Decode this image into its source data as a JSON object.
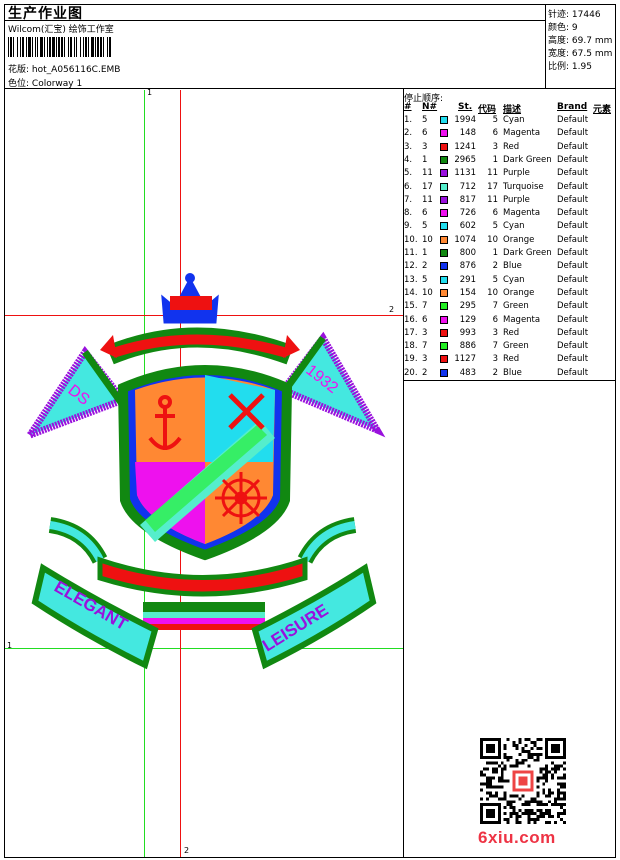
{
  "header": {
    "title": "生产作业图",
    "company": "Wilcom(汇宝) 绘饰工作室",
    "design_label": "花版:",
    "design_name": "hot_A056116C.EMB",
    "colorway_label": "色位:",
    "colorway_name": "Colorway 1"
  },
  "stats": {
    "stitches_label": "针迹:",
    "stitches": "17446",
    "colors_label": "颜色:",
    "colors": "9",
    "height_label": "高度:",
    "height": "69.7 mm",
    "width_label": "宽度:",
    "width": "67.5 mm",
    "scale_label": "比例:",
    "scale": "1.95"
  },
  "stop_sequence": {
    "title": "停止顺序:",
    "headers": {
      "idx": "#",
      "num": "N#",
      "st": "St.",
      "code": "代码",
      "desc": "描述",
      "brand": "Brand",
      "elem": "元素"
    },
    "rows": [
      {
        "idx": "1.",
        "n": "5",
        "color": "#22ddee",
        "st": "1994",
        "code": "5",
        "desc": "Cyan",
        "brand": "Default"
      },
      {
        "idx": "2.",
        "n": "6",
        "color": "#ee11ee",
        "st": "148",
        "code": "6",
        "desc": "Magenta",
        "brand": "Default"
      },
      {
        "idx": "3.",
        "n": "3",
        "color": "#ee1111",
        "st": "1241",
        "code": "3",
        "desc": "Red",
        "brand": "Default"
      },
      {
        "idx": "4.",
        "n": "1",
        "color": "#118811",
        "st": "2965",
        "code": "1",
        "desc": "Dark Green",
        "brand": "Default"
      },
      {
        "idx": "5.",
        "n": "11",
        "color": "#9911dd",
        "st": "1131",
        "code": "11",
        "desc": "Purple",
        "brand": "Default"
      },
      {
        "idx": "6.",
        "n": "17",
        "color": "#55eecc",
        "st": "712",
        "code": "17",
        "desc": "Turquoise",
        "brand": "Default"
      },
      {
        "idx": "7.",
        "n": "11",
        "color": "#9911dd",
        "st": "817",
        "code": "11",
        "desc": "Purple",
        "brand": "Default"
      },
      {
        "idx": "8.",
        "n": "6",
        "color": "#ee11ee",
        "st": "726",
        "code": "6",
        "desc": "Magenta",
        "brand": "Default"
      },
      {
        "idx": "9.",
        "n": "5",
        "color": "#22ddee",
        "st": "602",
        "code": "5",
        "desc": "Cyan",
        "brand": "Default"
      },
      {
        "idx": "10.",
        "n": "10",
        "color": "#ff8833",
        "st": "1074",
        "code": "10",
        "desc": "Orange",
        "brand": "Default"
      },
      {
        "idx": "11.",
        "n": "1",
        "color": "#118811",
        "st": "800",
        "code": "1",
        "desc": "Dark Green",
        "brand": "Default"
      },
      {
        "idx": "12.",
        "n": "2",
        "color": "#1133ee",
        "st": "876",
        "code": "2",
        "desc": "Blue",
        "brand": "Default"
      },
      {
        "idx": "13.",
        "n": "5",
        "color": "#22ddee",
        "st": "291",
        "code": "5",
        "desc": "Cyan",
        "brand": "Default"
      },
      {
        "idx": "14.",
        "n": "10",
        "color": "#ff8833",
        "st": "154",
        "code": "10",
        "desc": "Orange",
        "brand": "Default"
      },
      {
        "idx": "15.",
        "n": "7",
        "color": "#22ee22",
        "st": "295",
        "code": "7",
        "desc": "Green",
        "brand": "Default"
      },
      {
        "idx": "16.",
        "n": "6",
        "color": "#ee11ee",
        "st": "129",
        "code": "6",
        "desc": "Magenta",
        "brand": "Default"
      },
      {
        "idx": "17.",
        "n": "3",
        "color": "#ee1111",
        "st": "993",
        "code": "3",
        "desc": "Red",
        "brand": "Default"
      },
      {
        "idx": "18.",
        "n": "7",
        "color": "#22ee22",
        "st": "886",
        "code": "7",
        "desc": "Green",
        "brand": "Default"
      },
      {
        "idx": "19.",
        "n": "3",
        "color": "#ee1111",
        "st": "1127",
        "code": "3",
        "desc": "Red",
        "brand": "Default"
      },
      {
        "idx": "20.",
        "n": "2",
        "color": "#1133ee",
        "st": "483",
        "code": "2",
        "desc": "Blue",
        "brand": "Default"
      }
    ]
  },
  "design": {
    "guide_label_1": "1",
    "guide_label_2": "2",
    "banner_left": "ELEGANT",
    "banner_right": "LEISURE",
    "pennant_left": "DS",
    "pennant_right": "1932",
    "colors": {
      "guide_green": "#22dd22",
      "guide_red": "#ee1111",
      "cyan": "#22ddee",
      "magenta": "#ee11ee",
      "red": "#ee1111",
      "green": "#118811",
      "purple": "#9911dd",
      "orange": "#ff8833",
      "blue": "#1133ee"
    }
  },
  "watermark": {
    "site": "6xiu.com",
    "qr_icon": "qr-code-icon"
  }
}
